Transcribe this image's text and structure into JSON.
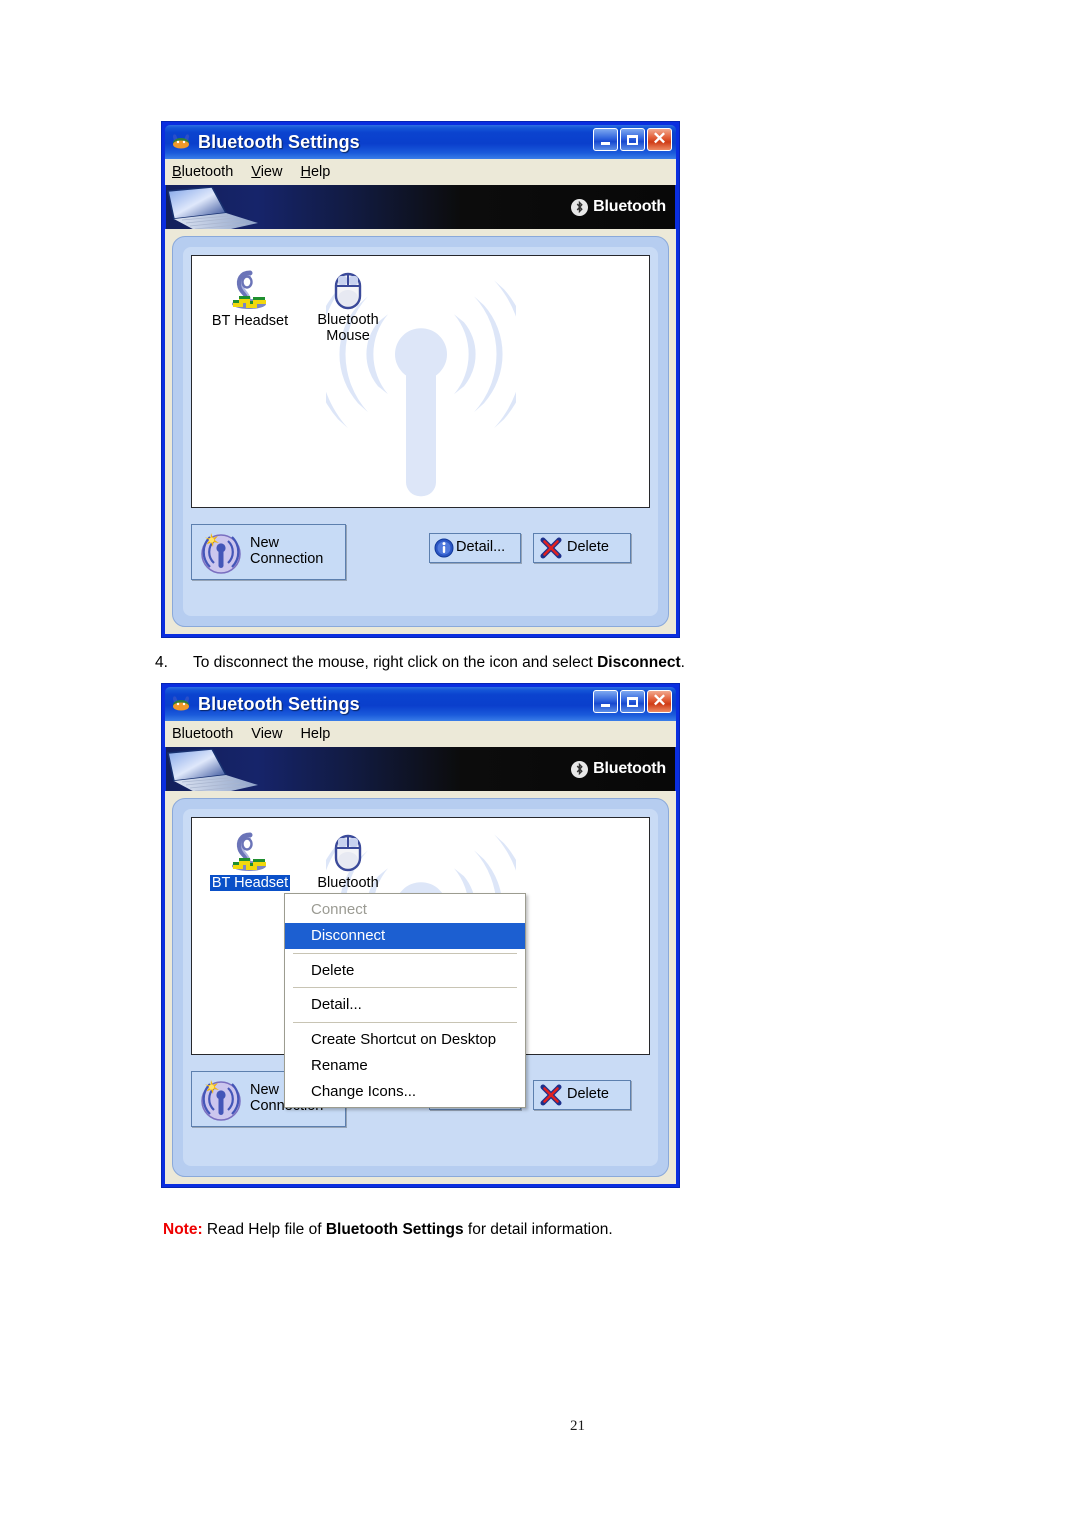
{
  "document": {
    "page_number": "21",
    "step": {
      "number": "4.",
      "text_before": "To disconnect the mouse, right click on the icon and select ",
      "bold": "Disconnect",
      "text_after": "."
    },
    "note": {
      "label": "Note:",
      "text_before": " Read Help file of ",
      "bold": "Bluetooth Settings",
      "text_after": " for detail information."
    }
  },
  "window1": {
    "title": "Bluetooth Settings",
    "app_icon": "bluetooth-settings-app-icon",
    "window_buttons": {
      "minimize": "minimize-button",
      "maximize": "maximize-button",
      "close": "close-button"
    },
    "menubar": [
      {
        "label": "Bluetooth",
        "accel": "B"
      },
      {
        "label": "View",
        "accel": "V"
      },
      {
        "label": "Help",
        "accel": "H"
      }
    ],
    "banner": {
      "logo_text": "Bluetooth",
      "registered_mark": "®"
    },
    "devices": [
      {
        "label": "BT Headset",
        "icon": "headset-icon",
        "selected": false
      },
      {
        "label": "Bluetooth\nMouse",
        "icon": "mouse-icon",
        "selected": false
      }
    ],
    "buttons": {
      "new_connection": "New\nConnection",
      "detail": "Detail...",
      "delete": "Delete"
    }
  },
  "window2": {
    "title": "Bluetooth Settings",
    "app_icon": "bluetooth-settings-app-icon",
    "window_buttons": {
      "minimize": "minimize-button",
      "maximize": "maximize-button",
      "close": "close-button"
    },
    "menubar": [
      {
        "label": "Bluetooth",
        "accel": ""
      },
      {
        "label": "View",
        "accel": ""
      },
      {
        "label": "Help",
        "accel": ""
      }
    ],
    "banner": {
      "logo_text": "Bluetooth",
      "registered_mark": "®"
    },
    "devices": [
      {
        "label": "BT Headset",
        "icon": "headset-icon",
        "selected": true
      },
      {
        "label": "Bluetooth",
        "icon": "mouse-icon",
        "selected": false
      }
    ],
    "buttons": {
      "new_connection": "New\nConnection",
      "delete": "Delete"
    },
    "context_menu": [
      {
        "label": "Connect",
        "state": "disabled"
      },
      {
        "label": "Disconnect",
        "state": "highlighted"
      },
      {
        "separator": true
      },
      {
        "label": "Delete",
        "state": "normal"
      },
      {
        "separator": true
      },
      {
        "label": "Detail...",
        "state": "normal"
      },
      {
        "separator": true
      },
      {
        "label": "Create Shortcut on Desktop",
        "state": "normal"
      },
      {
        "label": "Rename",
        "state": "normal"
      },
      {
        "label": "Change Icons...",
        "state": "normal"
      }
    ]
  },
  "colors": {
    "titlebar_blue": "#0b43cf",
    "window_border": "#0a2ee0",
    "panel_blue": "#b6cdf0",
    "inner_panel_blue": "#c9dbf5",
    "client_beige": "#ece9d8",
    "selection_blue": "#0a50c8",
    "menu_highlight": "#1c5fd1",
    "note_red": "#ee0000",
    "button_face": "#c7dbf6"
  }
}
